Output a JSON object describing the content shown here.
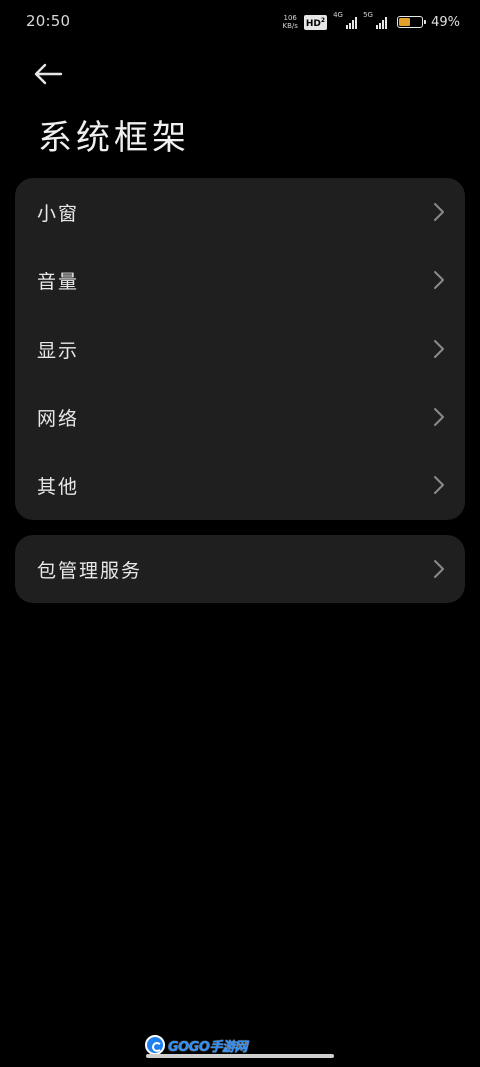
{
  "status_bar": {
    "time": "20:50",
    "net_speed_value": "106",
    "net_speed_unit": "KB/s",
    "hd_label": "HD",
    "hd_sub": "2",
    "sim1_label": "4G",
    "sim2_label": "5G",
    "battery_text": "49%",
    "battery_level": 0.49,
    "battery_color": "#e3a12c"
  },
  "header": {
    "back_icon": "arrow-left-icon",
    "title": "系统框架"
  },
  "groups": [
    {
      "items": [
        {
          "label": "小窗",
          "icon": "chevron-right-icon"
        },
        {
          "label": "音量",
          "icon": "chevron-right-icon"
        },
        {
          "label": "显示",
          "icon": "chevron-right-icon"
        },
        {
          "label": "网络",
          "icon": "chevron-right-icon"
        },
        {
          "label": "其他",
          "icon": "chevron-right-icon"
        }
      ]
    },
    {
      "items": [
        {
          "label": "包管理服务",
          "icon": "chevron-right-icon"
        }
      ]
    }
  ],
  "watermark": {
    "text": "GOGO手游网"
  },
  "colors": {
    "background": "#000000",
    "card": "#1f1f1f",
    "text": "#e8e8e8",
    "chevron": "#8a8a8a"
  }
}
